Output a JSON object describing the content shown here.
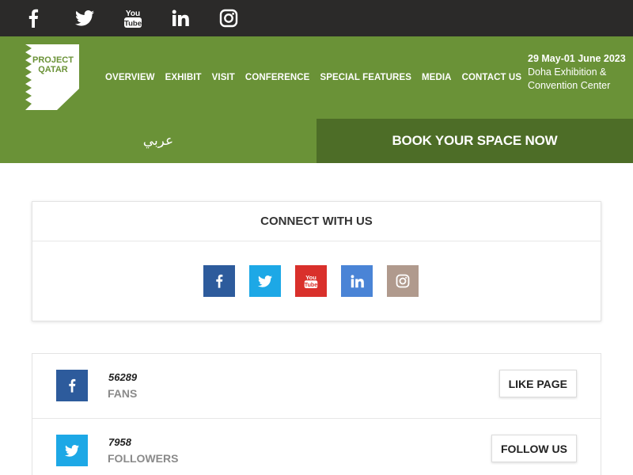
{
  "top_social": [
    {
      "icon": "facebook-icon"
    },
    {
      "icon": "twitter-icon"
    },
    {
      "icon": "youtube-icon"
    },
    {
      "icon": "linkedin-icon"
    },
    {
      "icon": "instagram-icon"
    }
  ],
  "logo": {
    "line1": "PROJECT",
    "line2": "QATAR"
  },
  "nav": {
    "items": [
      "OVERVIEW",
      "EXHIBIT",
      "VISIT",
      "CONFERENCE",
      "SPECIAL FEATURES",
      "MEDIA",
      "CONTACT US"
    ]
  },
  "event": {
    "date": "29 May-01 June 2023",
    "venue": "Doha Exhibition & Convention Center"
  },
  "actions": {
    "arabic_label": "عربي",
    "book_label": "BOOK YOUR SPACE NOW"
  },
  "connect": {
    "title": "CONNECT WITH US",
    "icons": [
      {
        "icon": "facebook-icon",
        "color": "#2d5b9c"
      },
      {
        "icon": "twitter-icon",
        "color": "#1da8e6"
      },
      {
        "icon": "youtube-icon",
        "color": "#d9302b"
      },
      {
        "icon": "linkedin-icon",
        "color": "#4a84d6"
      },
      {
        "icon": "instagram-icon",
        "color": "#b09a8d"
      }
    ]
  },
  "stats": [
    {
      "icon": "facebook-icon",
      "color": "#2d5b9c",
      "count": "56289",
      "label": "FANS",
      "button": "LIKE PAGE"
    },
    {
      "icon": "twitter-icon",
      "color": "#1da8e6",
      "count": "7958",
      "label": "FOLLOWERS",
      "button": "FOLLOW US"
    }
  ],
  "colors": {
    "topbar": "#2b2a29",
    "header_green": "#6a9237",
    "book_green": "#4d6d27"
  }
}
